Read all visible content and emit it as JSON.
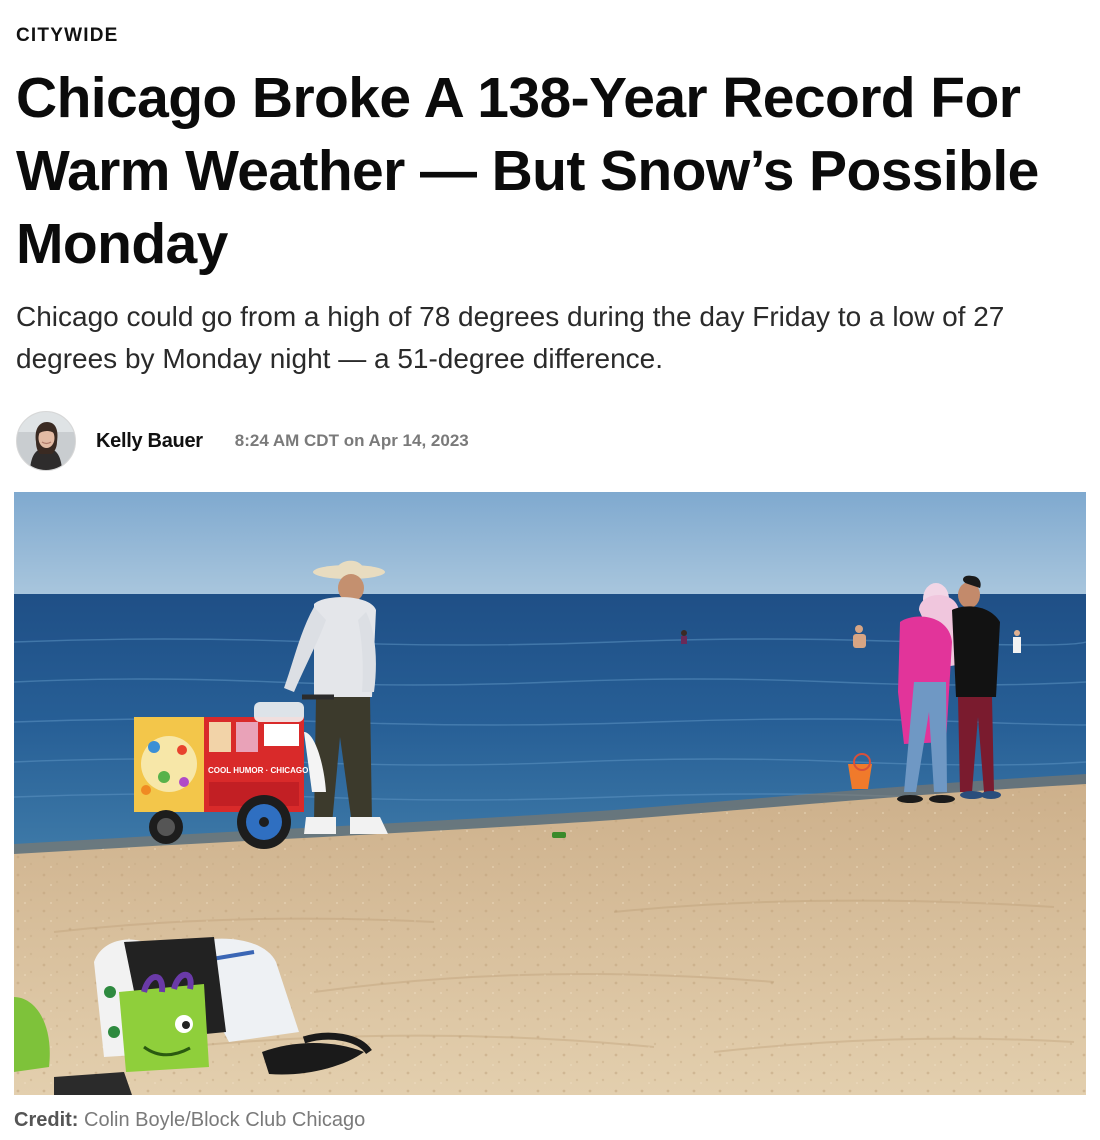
{
  "article": {
    "section_label": "CITYWIDE",
    "headline": "Chicago Broke A 138-Year Record For Warm Weather — But Snow’s Possible Monday",
    "dek": "Chicago could go from a high of 78 degrees during the day Friday to a low of 27 degrees by Monday night — a 51-degree difference.",
    "author_name": "Kelly Bauer",
    "published": "8:24 AM CDT on Apr 14, 2023"
  },
  "photo": {
    "alt": "Beach on Lake Michigan with an ice cream cart vendor and beachgoers",
    "cart_sign": "COOL HUMOR · CHICAGO",
    "credit_label": "Credit:",
    "credit_text": "Colin Boyle/Block Club Chicago"
  }
}
